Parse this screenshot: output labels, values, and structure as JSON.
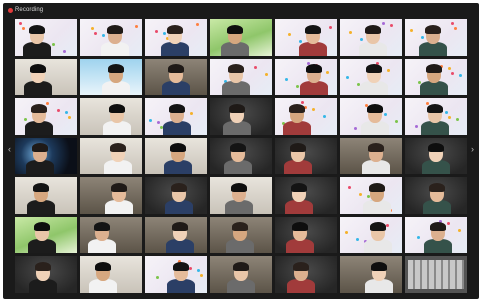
{
  "app": {
    "recording_label": "Recording"
  },
  "colors": {
    "recording_dot": "#e23b3b",
    "window_bg": "#1a1a1a"
  },
  "icons": {
    "left_arrow": "chevron-left-icon",
    "right_arrow": "chevron-right-icon"
  },
  "gallery": {
    "rows": 7,
    "columns": 7,
    "arrow_left": "‹",
    "arrow_right": "›"
  }
}
